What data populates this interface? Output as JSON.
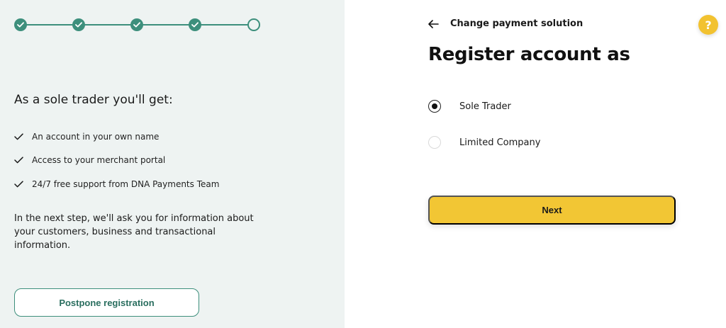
{
  "stepper": {
    "steps": [
      {
        "state": "complete"
      },
      {
        "state": "complete"
      },
      {
        "state": "complete"
      },
      {
        "state": "complete"
      },
      {
        "state": "current"
      }
    ],
    "accent_color": "#3d8f7c"
  },
  "benefits": {
    "title": "As a sole trader you'll get:",
    "items": [
      {
        "label": "An account in your own name",
        "icon": "check-icon"
      },
      {
        "label": "Access to your merchant portal",
        "icon": "check-icon"
      },
      {
        "label": "24/7 free support from DNA Payments Team",
        "icon": "check-icon"
      }
    ]
  },
  "info_text": "In the next step, we'll ask you for information about your customers, business and transactional information.",
  "postpone_label": "Postpone registration",
  "back": {
    "label": "Change payment solution",
    "icon": "arrow-left-icon"
  },
  "help": {
    "label": "?",
    "icon": "help-icon",
    "color": "#f2c230"
  },
  "title": "Register account as",
  "options": [
    {
      "label": "Sole Trader",
      "selected": true
    },
    {
      "label": "Limited Company",
      "selected": false
    }
  ],
  "next_label": "Next",
  "next_color": "#f2c634"
}
